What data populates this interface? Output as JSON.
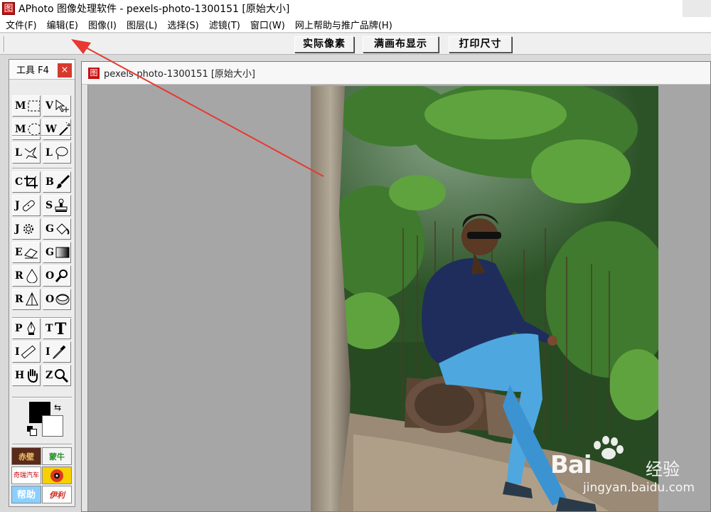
{
  "window": {
    "app_icon_glyph": "图",
    "title": "APhoto 图像处理软件 - pexels-photo-1300151 [原始大小]"
  },
  "menu": [
    {
      "label": "文件(F)",
      "name": "menu-file"
    },
    {
      "label": "编辑(E)",
      "name": "menu-edit"
    },
    {
      "label": "图像(I)",
      "name": "menu-image"
    },
    {
      "label": "图层(L)",
      "name": "menu-layer"
    },
    {
      "label": "选择(S)",
      "name": "menu-select"
    },
    {
      "label": "滤镜(T)",
      "name": "menu-filter"
    },
    {
      "label": "窗口(W)",
      "name": "menu-window"
    },
    {
      "label": "网上帮助与推广品牌(H)",
      "name": "menu-help"
    }
  ],
  "toolbar": {
    "actual_pixels": "实际像素",
    "fit_canvas": "满画布显示",
    "print_size": "打印尺寸"
  },
  "tools_panel": {
    "title": "工具  F4",
    "close_glyph": "×",
    "tools": [
      {
        "key": "M",
        "icon": "rect-marquee-icon"
      },
      {
        "key": "V",
        "icon": "move-icon"
      },
      {
        "key": "M",
        "icon": "ellipse-marquee-icon"
      },
      {
        "key": "W",
        "icon": "magic-wand-icon"
      },
      {
        "key": "L",
        "icon": "polygon-lasso-icon"
      },
      {
        "key": "L",
        "icon": "lasso-icon"
      },
      {
        "key": "C",
        "icon": "crop-icon"
      },
      {
        "key": "B",
        "icon": "brush-icon"
      },
      {
        "key": "J",
        "icon": "healing-bandage-icon"
      },
      {
        "key": "S",
        "icon": "clone-stamp-icon"
      },
      {
        "key": "J",
        "icon": "red-eye-icon"
      },
      {
        "key": "G",
        "icon": "paint-bucket-icon"
      },
      {
        "key": "E",
        "icon": "eraser-icon"
      },
      {
        "key": "G",
        "icon": "gradient-icon"
      },
      {
        "key": "R",
        "icon": "blur-drop-icon"
      },
      {
        "key": "O",
        "icon": "dodge-icon"
      },
      {
        "key": "R",
        "icon": "sharpen-icon"
      },
      {
        "key": "O",
        "icon": "sponge-icon"
      },
      {
        "key": "P",
        "icon": "pen-icon"
      },
      {
        "key": "T",
        "icon": "text-icon"
      },
      {
        "key": "I",
        "icon": "ruler-icon"
      },
      {
        "key": "I",
        "icon": "eyedropper-icon"
      },
      {
        "key": "H",
        "icon": "hand-icon"
      },
      {
        "key": "Z",
        "icon": "zoom-icon"
      }
    ],
    "swap_glyph": "⇆",
    "colors": {
      "foreground": "#000000",
      "background": "#ffffff"
    },
    "ads": [
      "赤壁",
      "蒙牛",
      "奇瑞汽车",
      "",
      "帮助",
      "伊利"
    ]
  },
  "document": {
    "icon_glyph": "图",
    "title": "pexels-photo-1300151 [原始大小]"
  },
  "watermark": {
    "brand": "Bai",
    "brand_suffix": "经验",
    "url": "jingyan.baidu.com"
  }
}
